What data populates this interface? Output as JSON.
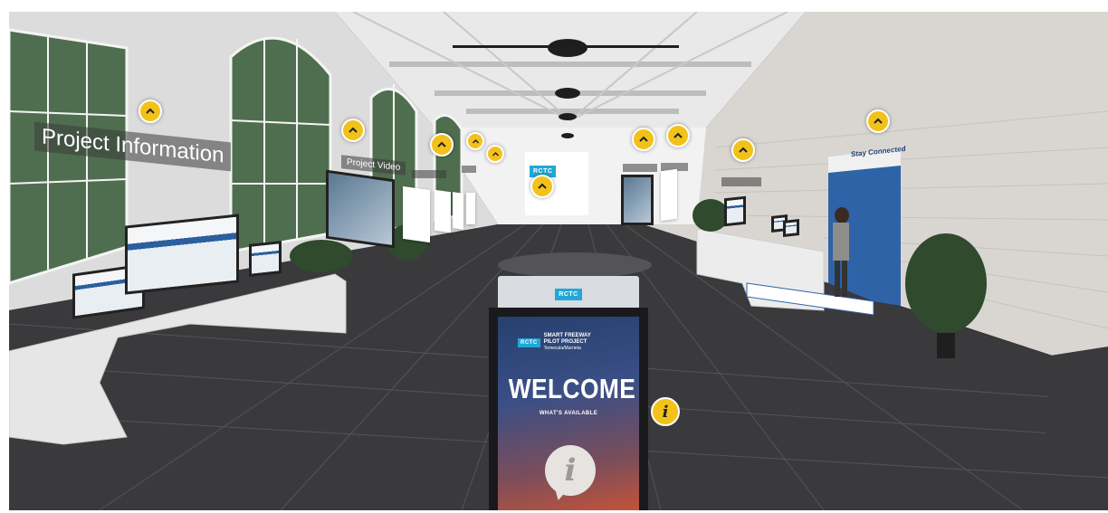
{
  "colors": {
    "hotspot": "#f2c21b",
    "rctc_blue": "#21a8d8",
    "accent_blue": "#2b5f9e"
  },
  "zones": {
    "project_information": "Project Information",
    "project_video": "Project Video",
    "stay_connected": "Stay Connected"
  },
  "kiosk": {
    "top_badge": "RCTC",
    "panel_badge": "RCTC",
    "project_name_line1": "SMART FREEWAY",
    "project_name_line2": "PILOT PROJECT",
    "project_location": "Temecula/Murrieta",
    "welcome": "WELCOME",
    "whats_available": "WHAT'S AVAILABLE",
    "info_glyph": "i"
  },
  "back_wall": {
    "badge": "RCTC"
  },
  "info_hotspot": {
    "glyph": "i"
  },
  "icons": {
    "hotspot": "chevron-up-icon",
    "info": "info-icon"
  }
}
